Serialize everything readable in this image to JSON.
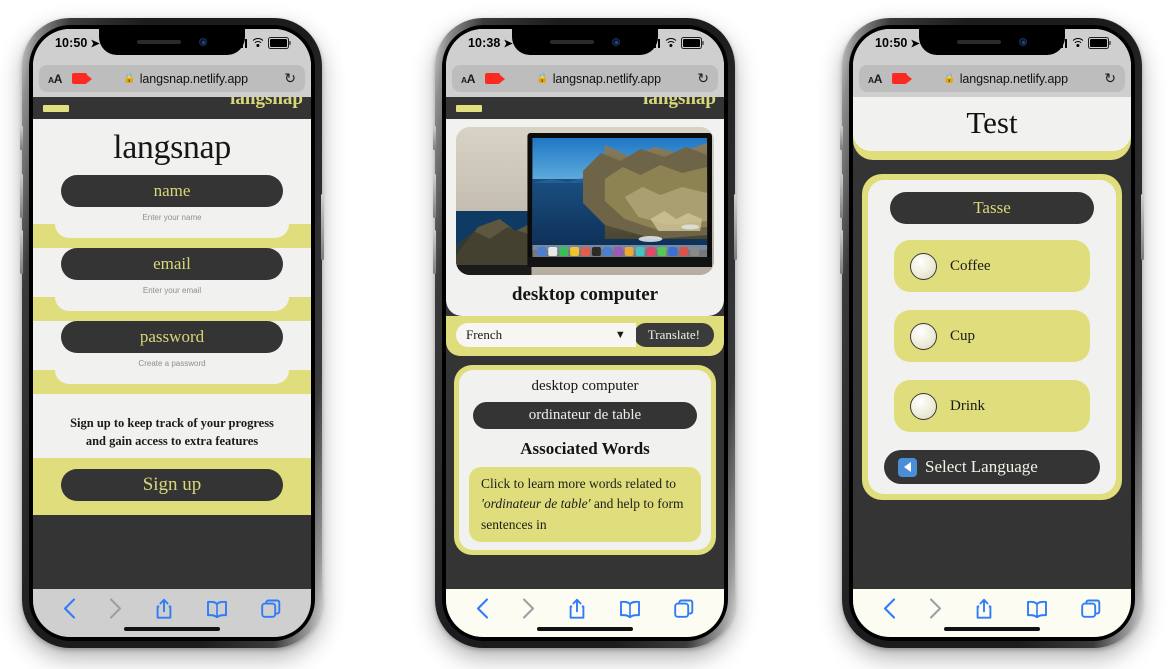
{
  "app": {
    "brand": "langsnap",
    "url": "langsnap.netlify.app",
    "lock_icon": "lock-icon",
    "reload_icon": "reload-icon",
    "text_size_icon": "AA",
    "camera_icon": "screen-recording-icon"
  },
  "phones": [
    {
      "id": "signup",
      "status": {
        "time": "10:50",
        "location_icon": "location-arrow-icon",
        "signal": "signal-icon",
        "wifi": "wifi-icon",
        "battery": "battery-icon"
      },
      "navbar": {
        "menu_icon": "hamburger-menu-icon",
        "logo": "langsnap"
      },
      "title": "langsnap",
      "fields": [
        {
          "label": "name",
          "placeholder": "Enter your name",
          "value": ""
        },
        {
          "label": "email",
          "placeholder": "Enter your email",
          "value": ""
        },
        {
          "label": "password",
          "placeholder": "Create a password",
          "value": ""
        }
      ],
      "blurb_line1": "Sign up to keep track of your progress",
      "blurb_line2": "and gain access to extra features",
      "submit": "Sign up",
      "toolbar": [
        "back-icon",
        "forward-icon",
        "share-icon",
        "bookmarks-icon",
        "tabs-icon"
      ]
    },
    {
      "id": "translate",
      "status": {
        "time": "10:38",
        "location_icon": "location-arrow-icon",
        "signal": "signal-icon",
        "wifi": "wifi-icon",
        "battery": "battery-icon"
      },
      "navbar": {
        "menu_icon": "hamburger-menu-icon",
        "logo": "langsnap"
      },
      "photo_alt": "desktop computer monitor showing macOS Catalina wallpaper",
      "word": "desktop computer",
      "language_selected": "French",
      "translate_button": "Translate!",
      "result_source_word": "desktop computer",
      "result_translation": "ordinateur de table",
      "associated_heading": "Associated Words",
      "associated_note_pre": "Click to learn more words related to ",
      "associated_note_em": "'ordinateur de table'",
      "associated_note_post": " and help to form sentences in",
      "toolbar": [
        "back-icon",
        "forward-icon",
        "share-icon",
        "bookmarks-icon",
        "tabs-icon"
      ]
    },
    {
      "id": "test",
      "status": {
        "time": "10:50",
        "location_icon": "location-arrow-icon",
        "signal": "signal-icon",
        "wifi": "wifi-icon",
        "battery": "battery-icon"
      },
      "title": "Test",
      "question_word": "Tasse",
      "options": [
        {
          "label": "Coffee",
          "selected": false
        },
        {
          "label": "Cup",
          "selected": false
        },
        {
          "label": "Drink",
          "selected": false
        }
      ],
      "back_button": "Select Language",
      "back_icon": "left-arrow-button-icon",
      "toolbar": [
        "back-icon",
        "forward-icon",
        "share-icon",
        "bookmarks-icon",
        "tabs-icon"
      ]
    }
  ],
  "colors": {
    "yellow": "#e0de7c",
    "dark": "#343434",
    "offwhite": "#f1f1f0",
    "safari_blue": "#2f7cf6",
    "chrome_gray": "#cfcfcf"
  }
}
